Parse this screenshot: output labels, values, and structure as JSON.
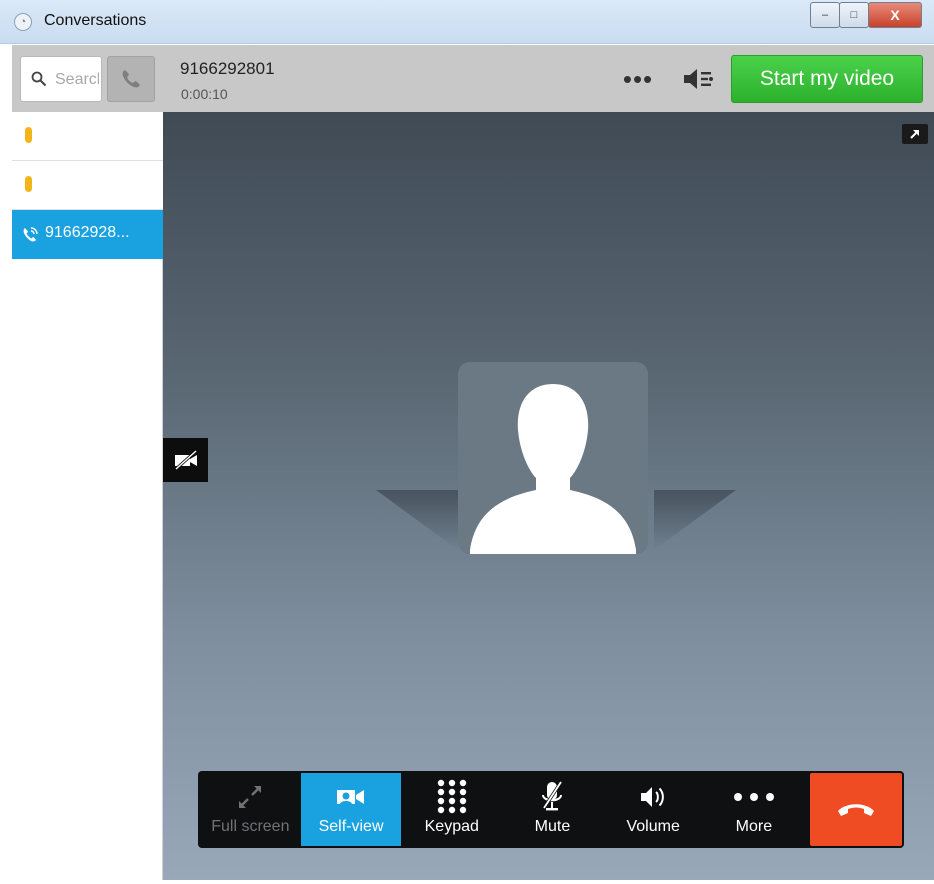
{
  "window": {
    "title": "Conversations",
    "controls": {
      "minimize": "–",
      "maximize": "□",
      "close": "X"
    }
  },
  "sidebar": {
    "search_placeholder": "Search",
    "conversations": [
      {
        "label": "",
        "status": "away"
      },
      {
        "label": "",
        "status": "away"
      },
      {
        "label": "91662928...",
        "status": "active-call"
      }
    ]
  },
  "call": {
    "number": "9166292801",
    "duration": "0:00:10",
    "more_label": "•••",
    "start_video_label": "Start my video"
  },
  "toolbar": {
    "fullscreen_label": "Full screen",
    "selfview_label": "Self-view",
    "keypad_label": "Keypad",
    "mute_label": "Mute",
    "volume_label": "Volume",
    "more_label": "More"
  },
  "colors": {
    "accent_blue": "#1aa1e0",
    "start_video_green": "#3cc23c",
    "end_call_red": "#f04c23",
    "presence_yellow": "#f2b418"
  }
}
